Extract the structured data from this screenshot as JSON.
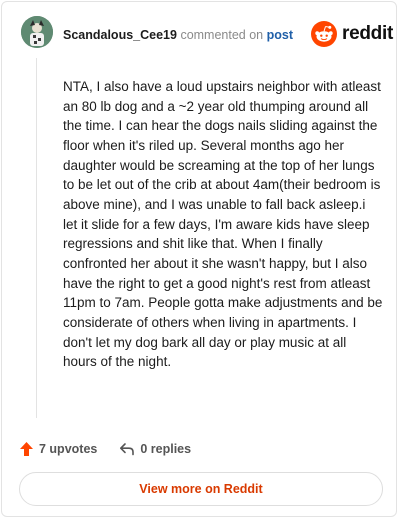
{
  "header": {
    "author": "Scandalous_Cee19",
    "commented_on": "commented on",
    "post_link": "post",
    "brand": "reddit"
  },
  "comment": {
    "body": "NTA, I also have a loud upstairs neighbor with atleast an 80 lb dog and a ~2 year old thumping around all the time. I can hear the dogs nails sliding against the floor when it's riled up. Several months ago her daughter would be screaming at the top of her lungs to be let out of the crib at about 4am(their bedroom is above mine), and I was unable to fall back asleep.i let it slide for a few days, I'm aware kids have sleep regressions and shit like that. When I finally confronted her about it she wasn't happy, but I also have the right to get a good night's rest from atleast 11pm to 7am. People gotta make adjustments and be considerate of others when living in apartments. I don't let my dog bark all day or play music at all hours of the night."
  },
  "footer": {
    "upvotes": "7 upvotes",
    "replies": "0 replies",
    "view_more": "View more on Reddit"
  },
  "icons": {
    "upvote": "upvote-arrow-icon",
    "reply": "reply-arrow-icon",
    "logo": "reddit-snoo-icon",
    "avatar": "user-avatar"
  },
  "colors": {
    "brand_orange": "#ff4500",
    "link_blue": "#1f5fa8",
    "view_more_text": "#d93a00"
  }
}
